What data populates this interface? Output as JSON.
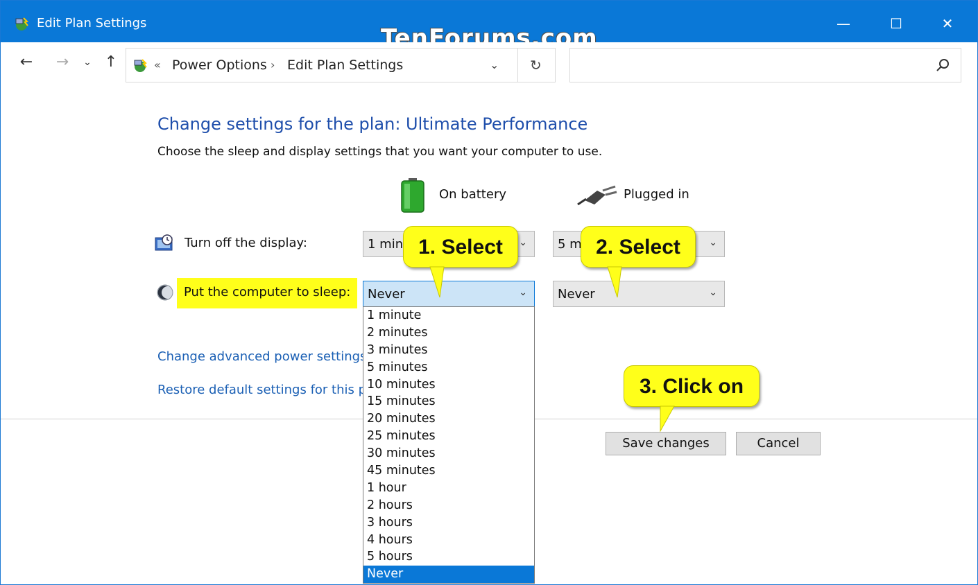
{
  "window": {
    "title": "Edit Plan Settings",
    "watermark": "TenForums.com",
    "minimize_glyph": "—",
    "maximize_glyph": "☐",
    "close_glyph": "✕"
  },
  "nav": {
    "back_glyph": "←",
    "forward_glyph": "→",
    "recent_glyph": "⌄",
    "up_glyph": "↑",
    "address_prefix": "«",
    "breadcrumbs": [
      "Power Options",
      "Edit Plan Settings"
    ],
    "separator": "›",
    "dropdown_glyph": "⌄",
    "refresh_glyph": "↻",
    "search_placeholder": ""
  },
  "main": {
    "heading": "Change settings for the plan: Ultimate Performance",
    "subheading": "Choose the sleep and display settings that you want your computer to use.",
    "columns": {
      "battery": "On battery",
      "plugged": "Plugged in"
    },
    "display": {
      "label": "Turn off the display:",
      "battery_value": "1 minute",
      "plugged_value": "5 minutes"
    },
    "sleep": {
      "label": "Put the computer to sleep:",
      "battery_value": "Never",
      "plugged_value": "Never"
    },
    "combo_arrow": "⌄",
    "links": {
      "advanced": "Change advanced power settings",
      "restore": "Restore default settings for this plan"
    },
    "buttons": {
      "save": "Save changes",
      "cancel": "Cancel"
    }
  },
  "dropdown": {
    "options": [
      "1 minute",
      "2 minutes",
      "3 minutes",
      "5 minutes",
      "10 minutes",
      "15 minutes",
      "20 minutes",
      "25 minutes",
      "30 minutes",
      "45 minutes",
      "1 hour",
      "2 hours",
      "3 hours",
      "4 hours",
      "5 hours",
      "Never"
    ],
    "selected": "Never"
  },
  "callouts": {
    "step1": "1. Select",
    "step2": "2. Select",
    "step3": "3. Click on"
  },
  "colors": {
    "titlebar": "#0a78d7",
    "heading": "#1e4eab",
    "link": "#1a5fb4",
    "highlight": "#ffff1a",
    "selection": "#0a78d7"
  }
}
